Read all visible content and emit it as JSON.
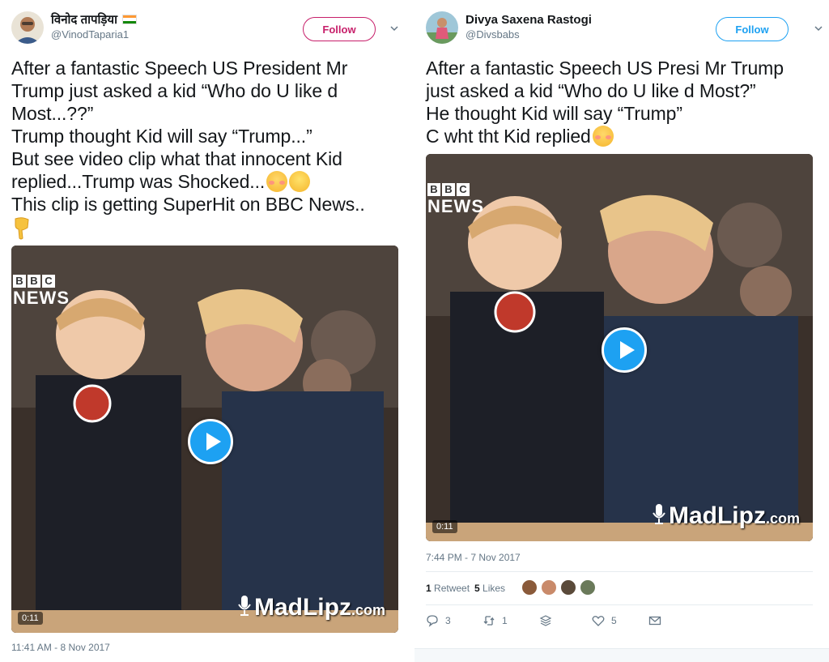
{
  "left_tweet": {
    "display_name": "विनोद तापड़िया",
    "handle": "@VinodTaparia1",
    "follow_label": "Follow",
    "text_lines": [
      "After a fantastic Speech US President Mr",
      "Trump just asked a kid “Who do U like d",
      "Most...??”",
      "Trump thought Kid will say “Trump...”",
      "But see video clip what that innocent Kid",
      "replied...Trump was Shocked...",
      "This clip is getting SuperHit on BBC News.."
    ],
    "video_duration": "0:11",
    "bbc_letters": [
      "B",
      "B",
      "C"
    ],
    "bbc_news": "NEWS",
    "watermark": "MadLipz",
    "watermark_suffix": ".com",
    "timestamp": "11:41 AM - 8 Nov 2017",
    "emojis": [
      "flushed-face",
      "grinning-face",
      "backhand-index-pointing-down"
    ],
    "flag": "india-flag"
  },
  "right_tweet": {
    "display_name": "Divya Saxena Rastogi",
    "handle": "@Divsbabs",
    "follow_label": "Follow",
    "text_lines": [
      "After a fantastic Speech US Presi Mr Trump",
      "just asked a kid “Who do U like d Most?”",
      "He thought Kid will say “Trump”",
      "C wht tht Kid replied"
    ],
    "video_duration": "0:11",
    "bbc_letters": [
      "B",
      "B",
      "C"
    ],
    "bbc_news": "NEWS",
    "watermark": "MadLipz",
    "watermark_suffix": ".com",
    "timestamp": "7:44 PM - 7 Nov 2017",
    "retweets_count": "1",
    "retweets_label": "Retweet",
    "likes_count": "5",
    "likes_label": "Likes",
    "actions": {
      "reply_count": "3",
      "retweet_count": "1",
      "like_count": "5"
    }
  },
  "colors": {
    "left_follow": "#c71f6a",
    "right_follow": "#1da1f2",
    "play_button": "#1da1f2",
    "muted_text": "#657786"
  }
}
